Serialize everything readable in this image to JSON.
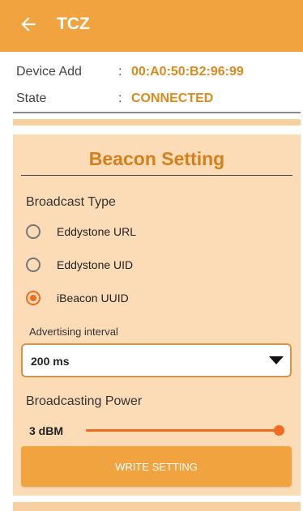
{
  "appbar": {
    "title": "TCZ",
    "back_icon": "back-arrow-icon",
    "background": "#f1a33f"
  },
  "device_info": {
    "address_label": "Device Add",
    "address_value": "00:A0:50:B2:96:99",
    "state_label": "State",
    "state_value": "CONNECTED",
    "separator": ":"
  },
  "beacon": {
    "title": "Beacon Setting",
    "broadcast_type_label": "Broadcast Type",
    "options": [
      {
        "label": "Eddystone URL",
        "checked": false
      },
      {
        "label": "Eddystone UID",
        "checked": false
      },
      {
        "label": "iBeacon UUID",
        "checked": true
      }
    ],
    "advertising_label": "Advertising interval",
    "advertising_value": "200 ms",
    "power_label": "Broadcasting Power",
    "power_value": "3 dBM",
    "power_level_fraction": 1.0,
    "write_button": "WRITE SETTING",
    "accent_color": "#f06b1e",
    "title_color": "#d47f1c",
    "card_color": "#fcdcb7"
  }
}
